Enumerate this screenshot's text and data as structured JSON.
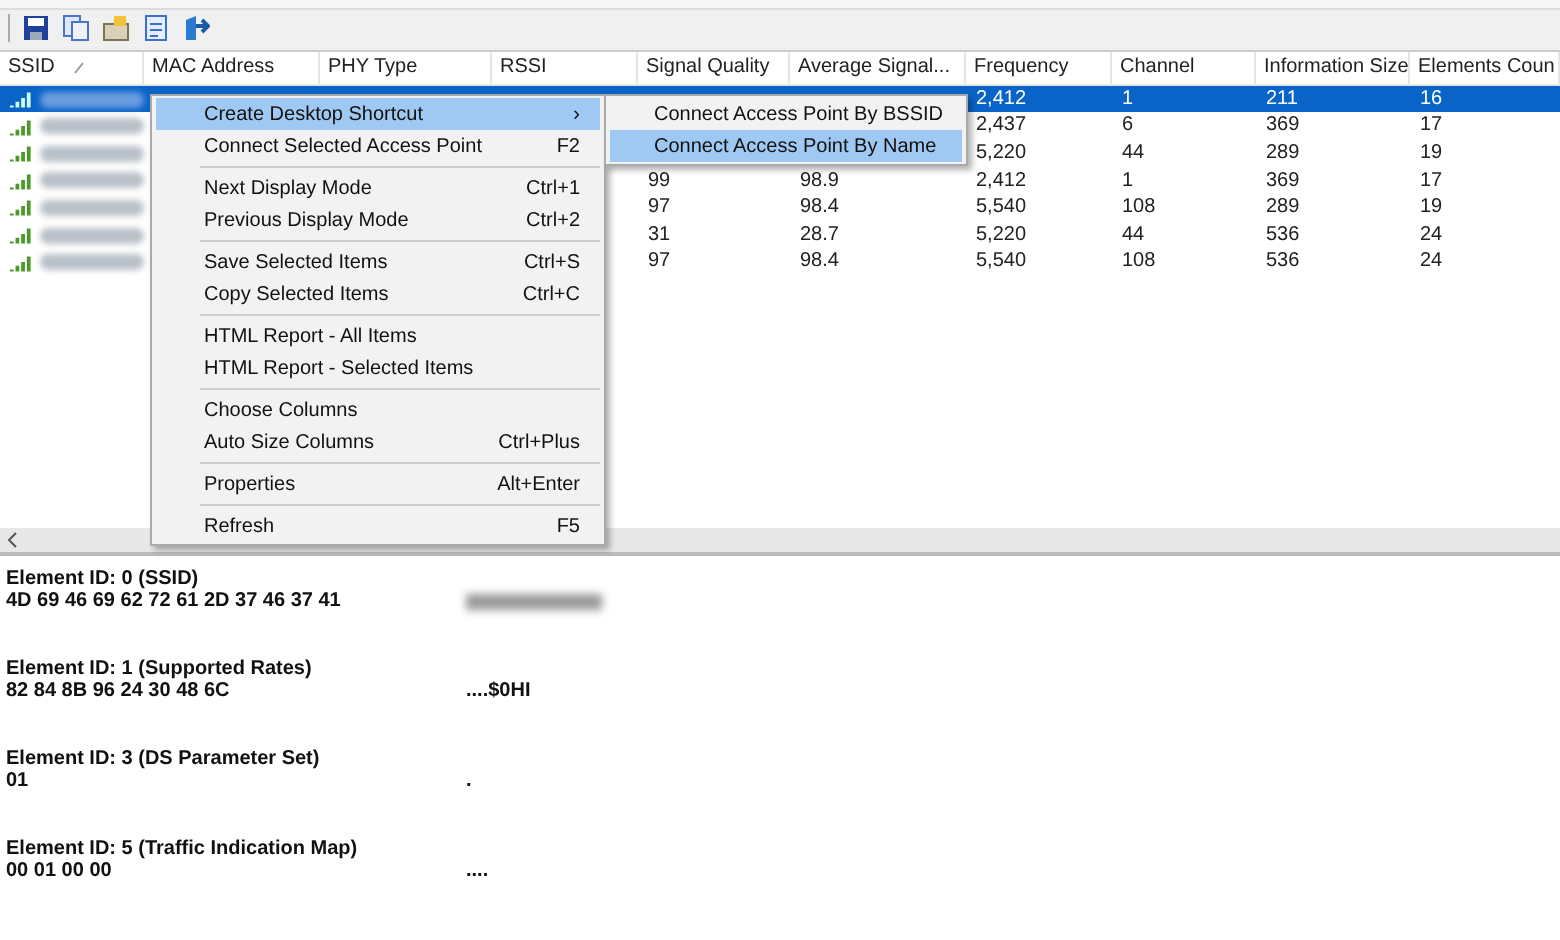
{
  "table": {
    "columns": [
      {
        "label": "SSID",
        "sorted": true
      },
      {
        "label": "MAC Address"
      },
      {
        "label": "PHY Type"
      },
      {
        "label": "RSSI"
      },
      {
        "label": "Signal Quality"
      },
      {
        "label": "Average Signal..."
      },
      {
        "label": "Frequency"
      },
      {
        "label": "Channel"
      },
      {
        "label": "Information Size"
      },
      {
        "label": "Elements Coun"
      }
    ],
    "rows": [
      {
        "selected": true,
        "cells": [
          "",
          "",
          "",
          "",
          "",
          "",
          "2,412",
          "1",
          "211",
          "16"
        ]
      },
      {
        "selected": false,
        "cells": [
          "",
          "",
          "",
          "",
          "",
          "",
          "2,437",
          "6",
          "369",
          "17"
        ]
      },
      {
        "selected": false,
        "cells": [
          "",
          "",
          "",
          "",
          "",
          "",
          "5,220",
          "44",
          "289",
          "19"
        ]
      },
      {
        "selected": false,
        "cells": [
          "",
          "",
          "",
          "",
          "99",
          "98.9",
          "2,412",
          "1",
          "369",
          "17"
        ]
      },
      {
        "selected": false,
        "cells": [
          "",
          "",
          "",
          "",
          "97",
          "98.4",
          "5,540",
          "108",
          "289",
          "19"
        ]
      },
      {
        "selected": false,
        "cells": [
          "",
          "",
          "",
          "",
          "31",
          "28.7",
          "5,220",
          "44",
          "536",
          "24"
        ]
      },
      {
        "selected": false,
        "cells": [
          "",
          "",
          "",
          "",
          "97",
          "98.4",
          "5,540",
          "108",
          "536",
          "24"
        ]
      }
    ]
  },
  "context_menu": {
    "groups": [
      [
        {
          "label": "Create Desktop Shortcut",
          "shortcut": "›",
          "selected": true
        },
        {
          "label": "Connect Selected Access Point",
          "shortcut": "F2",
          "selected": false
        }
      ],
      [
        {
          "label": "Next Display Mode",
          "shortcut": "Ctrl+1",
          "selected": false
        },
        {
          "label": "Previous Display Mode",
          "shortcut": "Ctrl+2",
          "selected": false
        }
      ],
      [
        {
          "label": "Save Selected Items",
          "shortcut": "Ctrl+S",
          "selected": false
        },
        {
          "label": "Copy Selected Items",
          "shortcut": "Ctrl+C",
          "selected": false
        }
      ],
      [
        {
          "label": "HTML Report - All Items",
          "selected": false
        },
        {
          "label": "HTML Report - Selected Items",
          "selected": false
        }
      ],
      [
        {
          "label": "Choose Columns",
          "selected": false
        },
        {
          "label": "Auto Size Columns",
          "shortcut": "Ctrl+Plus",
          "selected": false
        }
      ],
      [
        {
          "label": "Properties",
          "shortcut": "Alt+Enter",
          "selected": false
        }
      ],
      [
        {
          "label": "Refresh",
          "shortcut": "F5",
          "selected": false
        }
      ]
    ],
    "submenu": [
      {
        "label": "Connect Access Point By BSSID",
        "selected": false
      },
      {
        "label": "Connect Access Point By Name",
        "selected": true
      }
    ]
  },
  "details": [
    {
      "heading": "Element ID: 0  (SSID)",
      "hex": "4D 69 46 69 62 72 61 2D 37 46 37 41",
      "redacted": true
    },
    {
      "heading": "Element ID: 1  (Supported Rates)",
      "hex": "82 84 8B 96 24 30 48 6C",
      "ascii": "....$0HI",
      "redacted": false
    },
    {
      "heading": "Element ID: 3  (DS Parameter Set)",
      "hex": "01",
      "ascii": ".",
      "redacted": false
    },
    {
      "heading": "Element ID: 5  (Traffic Indication Map)",
      "hex": "00 01 00 00",
      "ascii": "....",
      "redacted": false
    }
  ]
}
